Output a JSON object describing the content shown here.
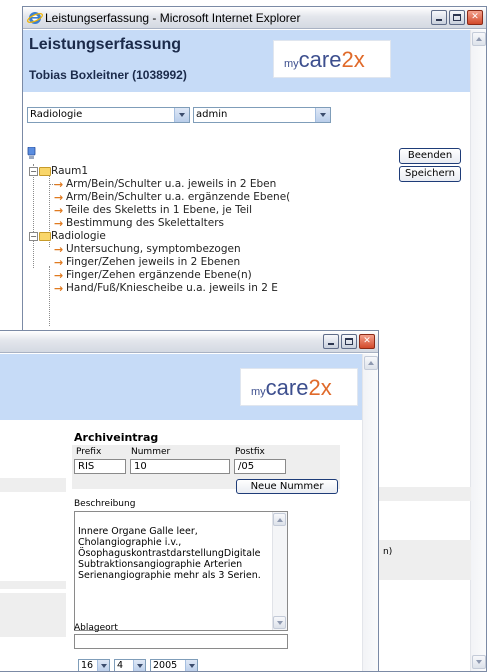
{
  "background_window": {
    "title": "Leistungserfassung - Microsoft Internet Explorer",
    "header_title": "Leistungserfassung",
    "patient": "Tobias Boxleitner (1038992)",
    "logo": {
      "my": "my",
      "care": "care",
      "two": "2x"
    },
    "department_select": "Radiologie",
    "user_select": "admin",
    "buttons": {
      "finish": "Beenden",
      "save": "Speichern"
    },
    "tree": [
      {
        "type": "folder",
        "label": "Raum1"
      },
      {
        "type": "item",
        "label": "Arm/Bein/Schulter u.a. jeweils in 2 Eben"
      },
      {
        "type": "item",
        "label": "Arm/Bein/Schulter u.a. ergänzende Ebene("
      },
      {
        "type": "item",
        "label": "Teile des Skeletts in 1 Ebene, je Teil"
      },
      {
        "type": "item",
        "label": "Bestimmung des Skelettalters"
      },
      {
        "type": "folder",
        "label": "Radiologie"
      },
      {
        "type": "item",
        "label": "Untersuchung, symptombezogen"
      },
      {
        "type": "item",
        "label": "Finger/Zehen jeweils in 2 Ebenen"
      },
      {
        "type": "item",
        "label": "Finger/Zehen ergänzende Ebene(n)"
      },
      {
        "type": "item",
        "label": "Hand/Fuß/Kniescheibe u.a. jeweils in 2 E"
      }
    ],
    "side_fragment": "n)"
  },
  "foreground_window": {
    "logo": {
      "my": "my",
      "care": "care",
      "two": "2x"
    },
    "section_title": "Archiveintrag",
    "labels": {
      "prefix": "Prefix",
      "number": "Nummer",
      "postfix": "Postfix",
      "description": "Beschreibung",
      "location": "Ablageort"
    },
    "values": {
      "prefix": "RIS",
      "number": "10",
      "postfix": "/05",
      "location": ""
    },
    "new_number_button": "Neue Nummer",
    "description": "Innere Organe Galle leer, Cholangiographie i.v., ÖsophaguskontrastdarstellungDigitale Subtraktionsangiographie Arterien Serienangiographie mehr als 3 Serien.",
    "date": {
      "day": "16",
      "month": "4",
      "year": "2005"
    }
  },
  "colors": {
    "header_band": "#c6dbf7",
    "logo_blue": "#3d4f8e",
    "logo_orange": "#e06a2a",
    "tree_arrow": "#e07a1f"
  }
}
